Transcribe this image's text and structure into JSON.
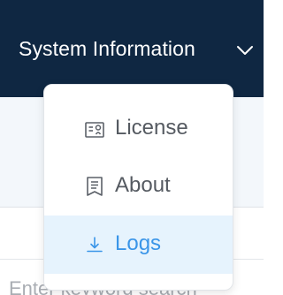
{
  "header": {
    "title": "System Information",
    "chevron_icon": "chevron-down-icon",
    "background": "#0f2742"
  },
  "menu": {
    "items": [
      {
        "label": "License",
        "icon": "license-card-icon",
        "selected": false
      },
      {
        "label": "About",
        "icon": "document-icon",
        "selected": false
      },
      {
        "label": "Logs",
        "icon": "download-icon",
        "selected": true
      }
    ],
    "selected_color": "#3a95e8",
    "selected_background": "#e6f3fd"
  },
  "search": {
    "placeholder": "Enter keyword search"
  }
}
